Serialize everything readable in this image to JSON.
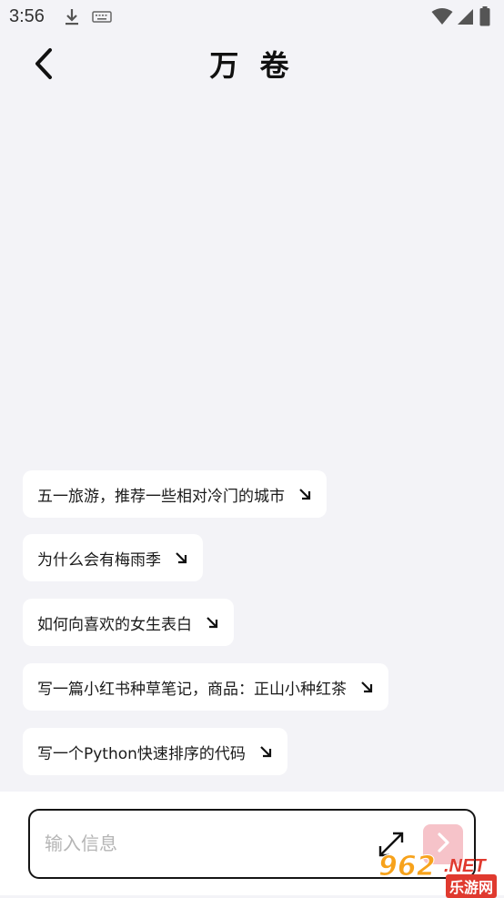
{
  "status_bar": {
    "time": "3:56",
    "icons": [
      "download-icon",
      "keyboard-icon",
      "wifi-icon",
      "signal-icon",
      "battery-icon"
    ]
  },
  "header": {
    "title": "万 卷",
    "back_icon": "chevron-left-icon"
  },
  "suggestions": [
    {
      "label": "五一旅游，推荐一些相对冷门的城市"
    },
    {
      "label": "为什么会有梅雨季"
    },
    {
      "label": "如何向喜欢的女生表白"
    },
    {
      "label": "写一篇小红书种草笔记，商品：正山小种红茶"
    },
    {
      "label": "写一个Python快速排序的代码"
    }
  ],
  "composer": {
    "placeholder": "输入信息",
    "value": "",
    "expand_icon": "expand-arrows-icon",
    "send_icon": "chevron-right-icon"
  },
  "watermark": {
    "main": "962",
    "suffix": ".NET",
    "sub": "乐游网"
  },
  "colors": {
    "background": "#f3f3f7",
    "card": "#ffffff",
    "send_button": "#f6c3c9",
    "text": "#111111",
    "placeholder": "#b5b5b5"
  }
}
